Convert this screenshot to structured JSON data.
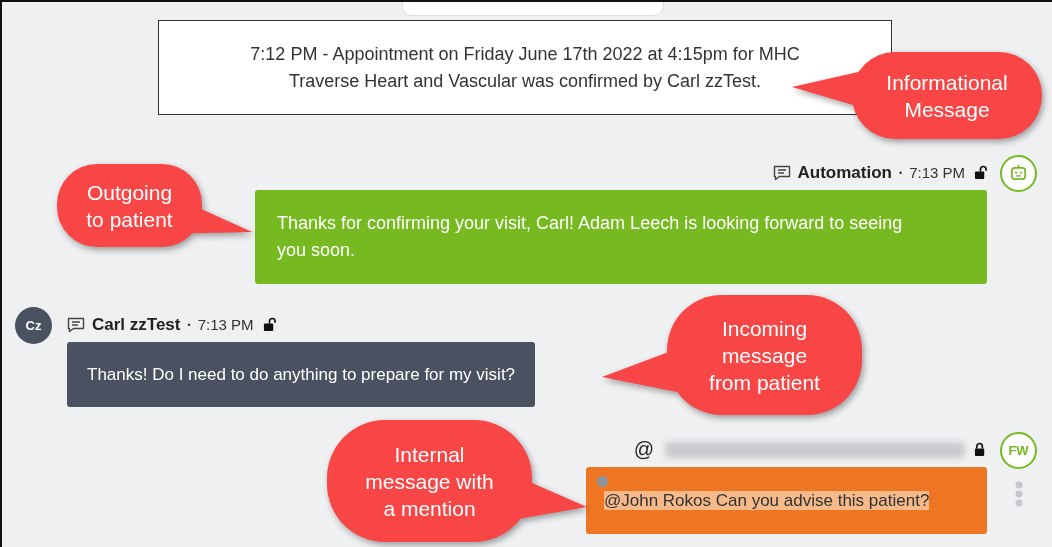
{
  "info_message": {
    "text": "7:12 PM - Appointment on Friday June 17th 2022 at 4:15pm for MHC Traverse Heart and Vascular was confirmed by Carl zzTest."
  },
  "messages": [
    {
      "kind": "outgoing",
      "avatar": {
        "kind": "bot"
      },
      "channel": {
        "kind": "sms"
      },
      "sender": "Automation",
      "separator": "•",
      "time": "7:13 PM",
      "locked": false,
      "highlighted": false,
      "text": "Thanks for confirming your visit, Carl! Adam Leech is looking forward to seeing you soon."
    },
    {
      "kind": "incoming",
      "avatar": {
        "kind": "initials",
        "text": "Cz"
      },
      "channel": {
        "kind": "sms"
      },
      "sender": "Carl zzTest",
      "separator": "•",
      "time": "7:13 PM",
      "locked": false,
      "highlighted": false,
      "text": "Thanks! Do I need to do anything to prepare for my visit?"
    },
    {
      "kind": "internal",
      "avatar": {
        "kind": "initials",
        "text": "FW"
      },
      "channel": {
        "kind": "mention",
        "symbol": "@"
      },
      "sender_redacted": true,
      "locked": true,
      "highlighted": true,
      "text": "@John Rokos Can you advise this patient?"
    }
  ],
  "annotations": [
    {
      "text": "Informational Message"
    },
    {
      "text": "Outgoing to patient"
    },
    {
      "text": "Incoming message from patient"
    },
    {
      "text": "Internal message with a mention"
    }
  ]
}
